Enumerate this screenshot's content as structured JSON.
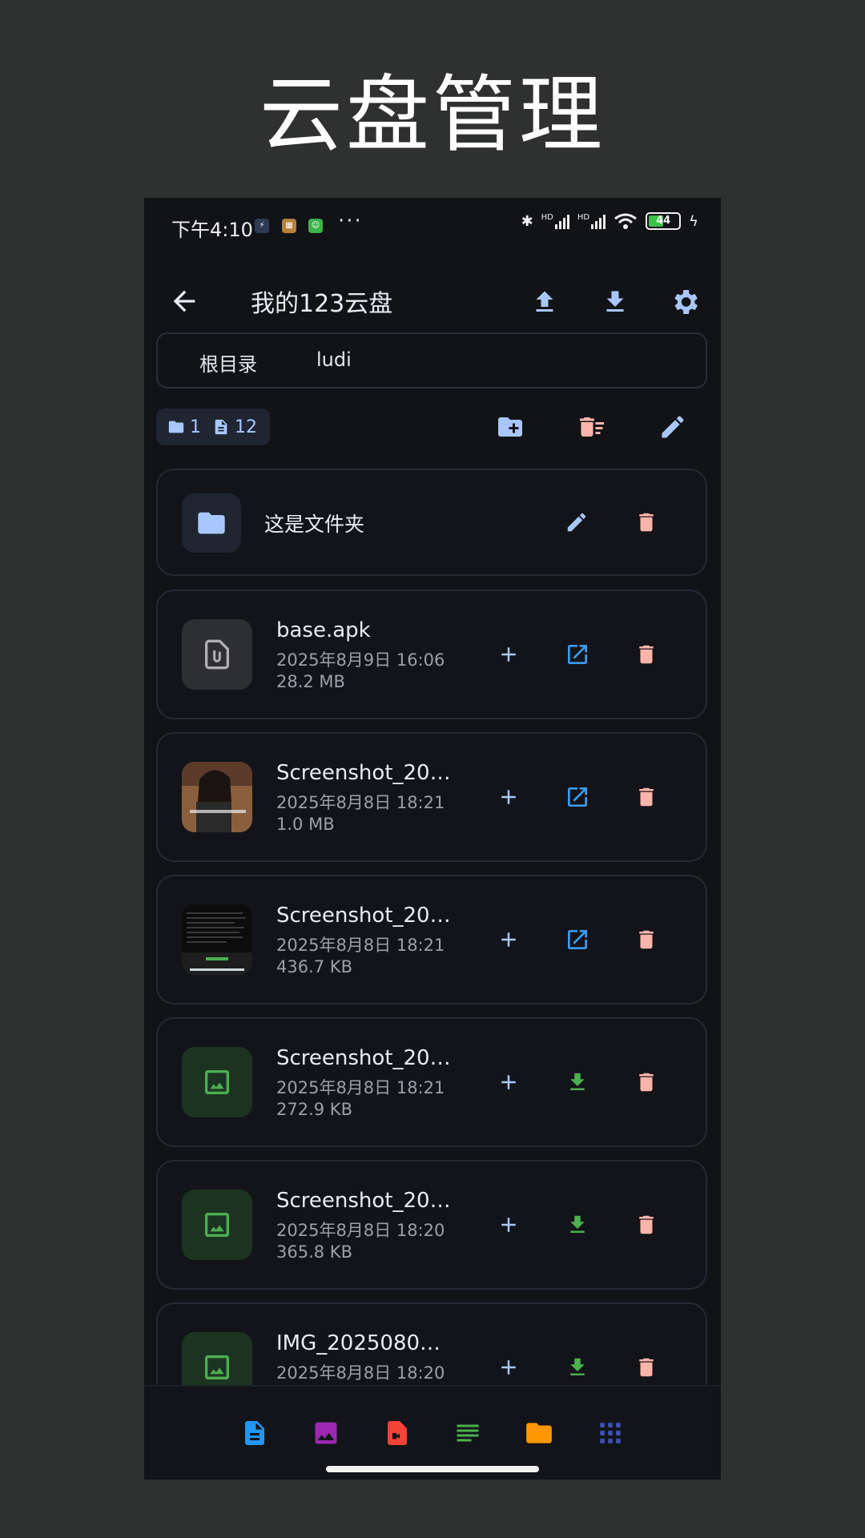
{
  "hero_title": "云盘管理",
  "status_bar": {
    "time": "下午4:10",
    "battery": "44",
    "hd1": "HD",
    "hd2": "HD"
  },
  "app_bar": {
    "title": "我的123云盘"
  },
  "breadcrumb": [
    "根目录",
    "ludi"
  ],
  "counts": {
    "folders": "1",
    "files": "12"
  },
  "folder_item": {
    "name": "这是文件夹"
  },
  "files": [
    {
      "name": "base.apk",
      "date": "2025年8月9日 16:06",
      "size": "28.2 MB",
      "thumb": "file-icon",
      "action": "open-external"
    },
    {
      "name": "Screenshot_20…",
      "date": "2025年8月8日 18:21",
      "size": "1.0 MB",
      "thumb": "photo-person",
      "action": "open-external"
    },
    {
      "name": "Screenshot_20…",
      "date": "2025年8月8日 18:21",
      "size": "436.7 KB",
      "thumb": "photo-dark",
      "action": "open-external"
    },
    {
      "name": "Screenshot_20…",
      "date": "2025年8月8日 18:21",
      "size": "272.9 KB",
      "thumb": "image-icon",
      "action": "download"
    },
    {
      "name": "Screenshot_20…",
      "date": "2025年8月8日 18:20",
      "size": "365.8 KB",
      "thumb": "image-icon",
      "action": "download"
    },
    {
      "name": "IMG_2025080…",
      "date": "2025年8月8日 18:20",
      "size": "",
      "thumb": "image-icon",
      "action": "download"
    }
  ],
  "bottom_nav": [
    "documents-icon",
    "images-icon",
    "videos-icon",
    "text-icon",
    "folders-icon",
    "apps-icon"
  ],
  "colors": {
    "accent_blue": "#a9c7ff",
    "link_blue": "#3b9cf0",
    "delete_pink": "#ffb4ab",
    "download_green": "#4caf50"
  }
}
